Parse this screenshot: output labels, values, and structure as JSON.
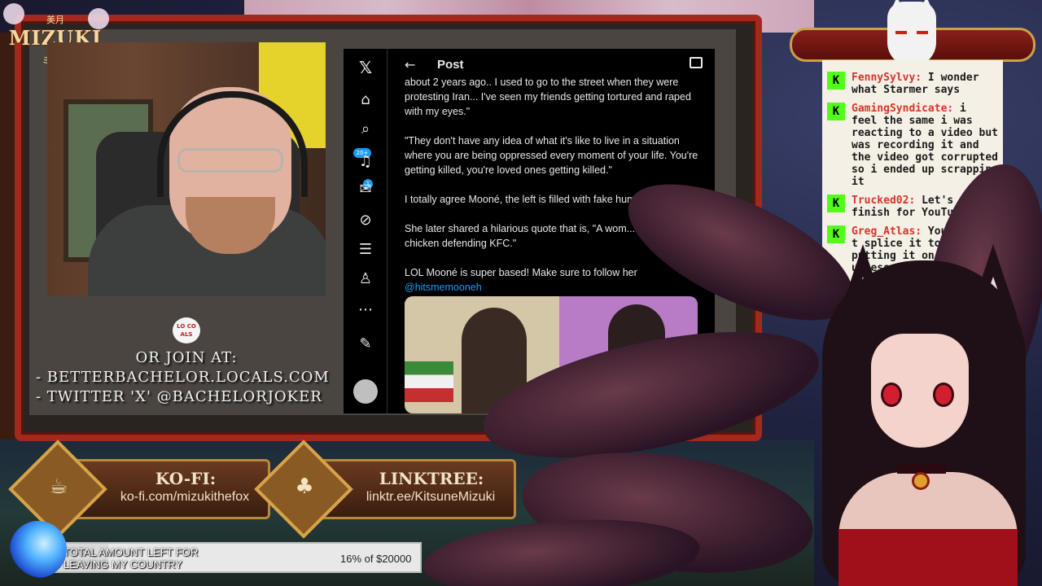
{
  "branding": {
    "logo_kanji": "美月",
    "logo_title": "MIZUKI",
    "logo_sub": "ミズキ"
  },
  "join": {
    "locals_logo": "LO CO ALS",
    "lines": [
      "OR JOIN AT:",
      "- BETTERBACHELOR.LOCALS.COM",
      "- TWITTER 'X' @BACHELORJOKER"
    ]
  },
  "x_app": {
    "header_title": "Post",
    "back_label": "←",
    "rail": {
      "items": [
        "x-logo",
        "home",
        "explore",
        "notifications",
        "messages",
        "grok",
        "lists",
        "profile",
        "more",
        "post"
      ],
      "notifications_badge": "20+",
      "messages_badge": "1"
    },
    "post_paragraphs": [
      "about 2 years ago.. I used to go to the street when they were protesting Iran... I've seen my friends getting tortured and raped with my eyes.\"",
      "\"They don't have any idea of what it's like to live in a situation where you are being oppressed every moment of your life. You're getting killed, you're loved ones getting killed.\"",
      "I totally agree Mooné, the left is filled with fake humanitarians!!",
      "She later shared a hilarious quote that is, \"A wom... Islam is like a chicken defending KFC.\""
    ],
    "post_last": "LOL Mooné is super based! Make sure to follow her",
    "post_mention": "@hitsmemooneh"
  },
  "chat": {
    "platform_icon": "K",
    "messages": [
      {
        "user": "FennySylvy:",
        "text": " I wonder what Starmer says"
      },
      {
        "user": "GamingSyndicate:",
        "text": " i feel the same i was reacting to a video but was recording it and the video got corrupted so i ended up scrapping it"
      },
      {
        "user": "Trucked02:",
        "text": " Let's finish for YouTube xD"
      },
      {
        "user": "Greg_Atlas:",
        "text": " You'd have t splice it together if putting it on youtub unless you restart ...o."
      }
    ]
  },
  "donations": {
    "kofi": {
      "title": "KO-FI:",
      "url": "ko-fi.com/mizukithefox"
    },
    "linktree": {
      "title": "LINKTREE:",
      "url": "linktr.ee/KitsuneMizuki"
    }
  },
  "goal": {
    "label_line1": "TOTAL AMOUNT LEFT FOR",
    "label_line2": "LEAVING MY COUNTRY",
    "amount_text": "16% of $20000",
    "progress": 0.16
  },
  "colors": {
    "frame_red": "#a3281e",
    "x_blue": "#1d9bf0",
    "kick_green": "#53fc18",
    "chat_user_red": "#d6342a"
  }
}
